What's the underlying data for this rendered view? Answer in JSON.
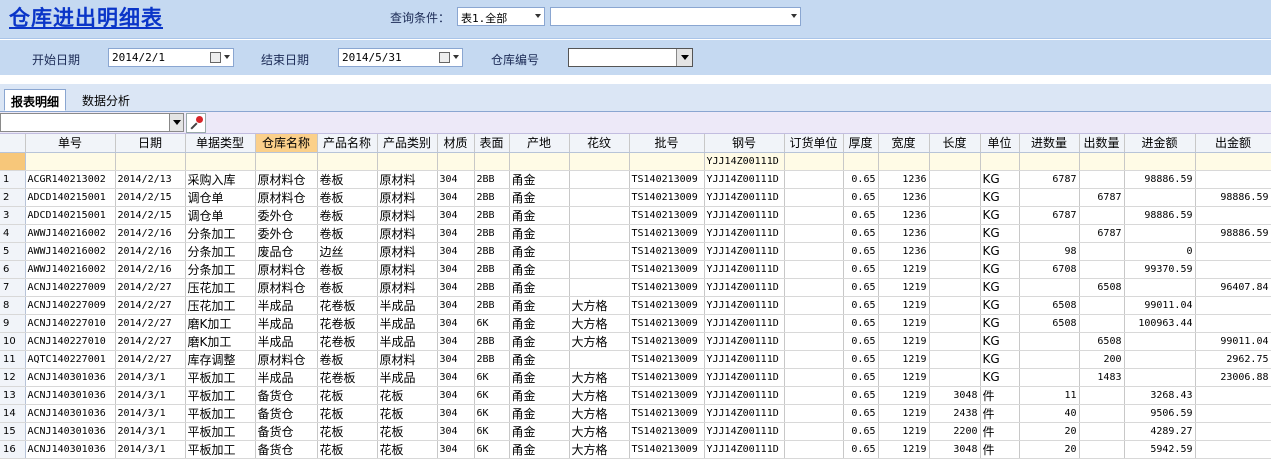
{
  "header": {
    "title": "仓库进出明细表",
    "query_label": "查询条件：",
    "query_table_value": "表1.全部",
    "query_extra_value": ""
  },
  "filters": {
    "start_label": "开始日期",
    "start_value": "2014/2/1",
    "end_label": "结束日期",
    "end_value": "2014/5/31",
    "warehouse_label": "仓库编号",
    "warehouse_value": ""
  },
  "tabs": [
    {
      "label": "报表明细",
      "active": true
    },
    {
      "label": "数据分析",
      "active": false
    }
  ],
  "grid": {
    "columns": [
      "单号",
      "日期",
      "单据类型",
      "仓库名称",
      "产品名称",
      "产品类别",
      "材质",
      "表面",
      "产地",
      "花纹",
      "批号",
      "钢号",
      "订货单位",
      "厚度",
      "宽度",
      "长度",
      "单位",
      "进数量",
      "出数量",
      "进金额",
      "出金额"
    ],
    "filter_row": [
      "",
      "",
      "",
      "",
      "",
      "",
      "",
      "",
      "",
      "",
      "",
      "YJJ14Z00111D",
      "",
      "",
      "",
      "",
      "",
      "",
      "",
      "",
      ""
    ],
    "rows": [
      {
        "n": "1",
        "c": [
          "ACGR140213002",
          "2014/2/13",
          "采购入库",
          "原材料仓",
          "卷板",
          "原材料",
          "304",
          "2BB",
          "甬金",
          "",
          "TS140213009",
          "YJJ14Z00111D",
          "",
          "0.65",
          "1236",
          "",
          "KG",
          "6787",
          "",
          "98886.59",
          ""
        ]
      },
      {
        "n": "2",
        "c": [
          "ADCD140215001",
          "2014/2/15",
          "调仓单",
          "原材料仓",
          "卷板",
          "原材料",
          "304",
          "2BB",
          "甬金",
          "",
          "TS140213009",
          "YJJ14Z00111D",
          "",
          "0.65",
          "1236",
          "",
          "KG",
          "",
          "6787",
          "",
          "98886.59"
        ]
      },
      {
        "n": "3",
        "c": [
          "ADCD140215001",
          "2014/2/15",
          "调仓单",
          "委外仓",
          "卷板",
          "原材料",
          "304",
          "2BB",
          "甬金",
          "",
          "TS140213009",
          "YJJ14Z00111D",
          "",
          "0.65",
          "1236",
          "",
          "KG",
          "6787",
          "",
          "98886.59",
          ""
        ]
      },
      {
        "n": "4",
        "c": [
          "AWWJ140216002",
          "2014/2/16",
          "分条加工",
          "委外仓",
          "卷板",
          "原材料",
          "304",
          "2BB",
          "甬金",
          "",
          "TS140213009",
          "YJJ14Z00111D",
          "",
          "0.65",
          "1236",
          "",
          "KG",
          "",
          "6787",
          "",
          "98886.59"
        ]
      },
      {
        "n": "5",
        "c": [
          "AWWJ140216002",
          "2014/2/16",
          "分条加工",
          "废品仓",
          "边丝",
          "原材料",
          "304",
          "2BB",
          "甬金",
          "",
          "TS140213009",
          "YJJ14Z00111D",
          "",
          "0.65",
          "1236",
          "",
          "KG",
          "98",
          "",
          "0",
          ""
        ]
      },
      {
        "n": "6",
        "c": [
          "AWWJ140216002",
          "2014/2/16",
          "分条加工",
          "原材料仓",
          "卷板",
          "原材料",
          "304",
          "2BB",
          "甬金",
          "",
          "TS140213009",
          "YJJ14Z00111D",
          "",
          "0.65",
          "1219",
          "",
          "KG",
          "6708",
          "",
          "99370.59",
          ""
        ]
      },
      {
        "n": "7",
        "c": [
          "ACNJ140227009",
          "2014/2/27",
          "压花加工",
          "原材料仓",
          "卷板",
          "原材料",
          "304",
          "2BB",
          "甬金",
          "",
          "TS140213009",
          "YJJ14Z00111D",
          "",
          "0.65",
          "1219",
          "",
          "KG",
          "",
          "6508",
          "",
          "96407.84"
        ]
      },
      {
        "n": "8",
        "c": [
          "ACNJ140227009",
          "2014/2/27",
          "压花加工",
          "半成品",
          "花卷板",
          "半成品",
          "304",
          "2BB",
          "甬金",
          "大方格",
          "TS140213009",
          "YJJ14Z00111D",
          "",
          "0.65",
          "1219",
          "",
          "KG",
          "6508",
          "",
          "99011.04",
          ""
        ]
      },
      {
        "n": "9",
        "c": [
          "ACNJ140227010",
          "2014/2/27",
          "磨K加工",
          "半成品",
          "花卷板",
          "半成品",
          "304",
          "6K",
          "甬金",
          "大方格",
          "TS140213009",
          "YJJ14Z00111D",
          "",
          "0.65",
          "1219",
          "",
          "KG",
          "6508",
          "",
          "100963.44",
          ""
        ]
      },
      {
        "n": "10",
        "c": [
          "ACNJ140227010",
          "2014/2/27",
          "磨K加工",
          "半成品",
          "花卷板",
          "半成品",
          "304",
          "2BB",
          "甬金",
          "大方格",
          "TS140213009",
          "YJJ14Z00111D",
          "",
          "0.65",
          "1219",
          "",
          "KG",
          "",
          "6508",
          "",
          "99011.04"
        ]
      },
      {
        "n": "11",
        "c": [
          "AQTC140227001",
          "2014/2/27",
          "库存调整",
          "原材料仓",
          "卷板",
          "原材料",
          "304",
          "2BB",
          "甬金",
          "",
          "TS140213009",
          "YJJ14Z00111D",
          "",
          "0.65",
          "1219",
          "",
          "KG",
          "",
          "200",
          "",
          "2962.75"
        ]
      },
      {
        "n": "12",
        "c": [
          "ACNJ140301036",
          "2014/3/1",
          "平板加工",
          "半成品",
          "花卷板",
          "半成品",
          "304",
          "6K",
          "甬金",
          "大方格",
          "TS140213009",
          "YJJ14Z00111D",
          "",
          "0.65",
          "1219",
          "",
          "KG",
          "",
          "1483",
          "",
          "23006.88"
        ]
      },
      {
        "n": "13",
        "c": [
          "ACNJ140301036",
          "2014/3/1",
          "平板加工",
          "备货仓",
          "花板",
          "花板",
          "304",
          "6K",
          "甬金",
          "大方格",
          "TS140213009",
          "YJJ14Z00111D",
          "",
          "0.65",
          "1219",
          "3048",
          "件",
          "11",
          "",
          "3268.43",
          ""
        ]
      },
      {
        "n": "14",
        "c": [
          "ACNJ140301036",
          "2014/3/1",
          "平板加工",
          "备货仓",
          "花板",
          "花板",
          "304",
          "6K",
          "甬金",
          "大方格",
          "TS140213009",
          "YJJ14Z00111D",
          "",
          "0.65",
          "1219",
          "2438",
          "件",
          "40",
          "",
          "9506.59",
          ""
        ]
      },
      {
        "n": "15",
        "c": [
          "ACNJ140301036",
          "2014/3/1",
          "平板加工",
          "备货仓",
          "花板",
          "花板",
          "304",
          "6K",
          "甬金",
          "大方格",
          "TS140213009",
          "YJJ14Z00111D",
          "",
          "0.65",
          "1219",
          "2200",
          "件",
          "20",
          "",
          "4289.27",
          ""
        ]
      },
      {
        "n": "16",
        "c": [
          "ACNJ140301036",
          "2014/3/1",
          "平板加工",
          "备货仓",
          "花板",
          "花板",
          "304",
          "6K",
          "甬金",
          "大方格",
          "TS140213009",
          "YJJ14Z00111D",
          "",
          "0.65",
          "1219",
          "3048",
          "件",
          "20",
          "",
          "5942.59",
          ""
        ]
      }
    ]
  }
}
